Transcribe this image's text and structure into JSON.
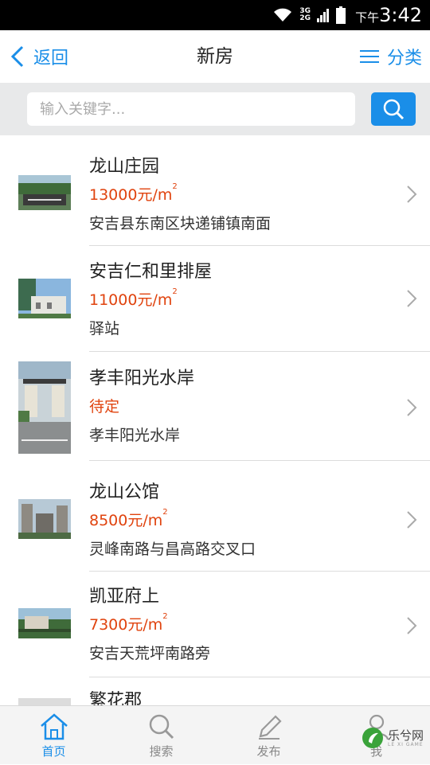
{
  "status": {
    "network_top": "3G",
    "network_bottom": "2G",
    "ampm": "下午",
    "time": "3:42"
  },
  "nav": {
    "back_label": "返回",
    "title": "新房",
    "category_label": "分类"
  },
  "search": {
    "placeholder": "输入关键字..."
  },
  "listings": [
    {
      "name": "龙山庄园",
      "price": "13000元/m",
      "price_sup": "2",
      "address": "安吉县东南区块递铺镇南面"
    },
    {
      "name": "安吉仁和里排屋",
      "price": "11000元/m",
      "price_sup": "2",
      "address": "驿站"
    },
    {
      "name": "孝丰阳光水岸",
      "price": "待定",
      "price_sup": "",
      "address": "孝丰阳光水岸"
    },
    {
      "name": "龙山公馆",
      "price": "8500元/m",
      "price_sup": "2",
      "address": "灵峰南路与昌高路交叉口"
    },
    {
      "name": "凯亚府上",
      "price": "7300元/m",
      "price_sup": "2",
      "address": "安吉天荒坪南路旁"
    },
    {
      "name": "繁花郡",
      "price": "",
      "price_sup": "",
      "address": ""
    }
  ],
  "tabs": [
    {
      "label": "首页",
      "icon": "home-icon"
    },
    {
      "label": "搜索",
      "icon": "search-icon"
    },
    {
      "label": "发布",
      "icon": "pencil-icon"
    },
    {
      "label": "我",
      "icon": "user-icon"
    }
  ],
  "watermark": {
    "text": "乐兮网",
    "sub": "LE XI GAME"
  },
  "colors": {
    "accent": "#1a8ee8",
    "price": "#e0430e",
    "status_bar": "#000000",
    "search_bg": "#e8e9ea"
  }
}
